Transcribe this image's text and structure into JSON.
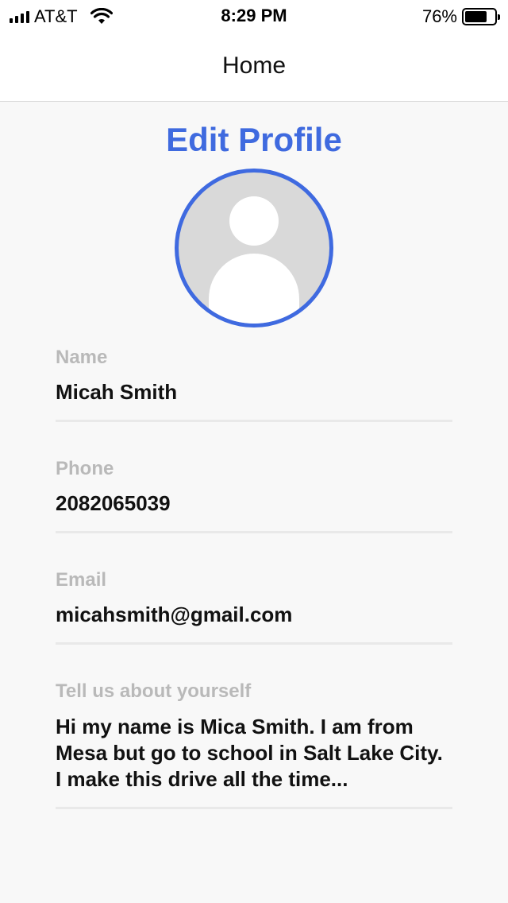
{
  "status_bar": {
    "carrier": "AT&T",
    "time": "8:29 PM",
    "battery_percent": "76%",
    "battery_level": 0.76,
    "icons": [
      "signal-icon",
      "wifi-icon",
      "battery-icon"
    ]
  },
  "nav": {
    "title": "Home"
  },
  "main": {
    "title": "Edit Profile",
    "accent_color": "#3f6adf",
    "avatar_icon": "person-icon",
    "fields": {
      "name": {
        "label": "Name",
        "value": "Micah Smith"
      },
      "phone": {
        "label": "Phone",
        "value": "2082065039"
      },
      "email": {
        "label": "Email",
        "value": "micahsmith@gmail.com"
      },
      "bio": {
        "label": "Tell us about yourself",
        "value": "Hi my name is Mica Smith. I am from Mesa but go to school in Salt Lake City. I make this drive all the time..."
      }
    }
  }
}
